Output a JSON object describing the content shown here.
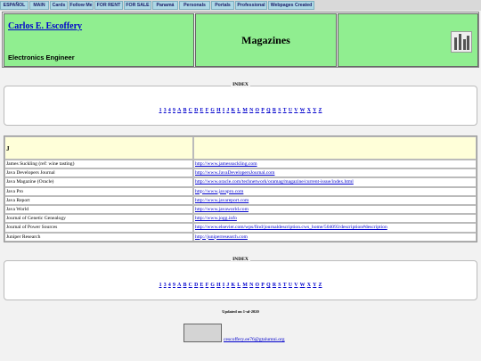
{
  "nav": [
    "ESPAÑOL",
    "MAIN",
    "Cards",
    "Follow Me",
    "FOR RENT",
    "FOR SALE",
    "Panamá",
    "Personals",
    "Portals",
    "Professional",
    "Webpages Created"
  ],
  "header": {
    "name": "Carlos E. Escoffery",
    "subtitle": "Electronics Engineer",
    "title": "Magazines",
    "thumb_icon": "building-photo"
  },
  "index": {
    "label": "INDEX",
    "links": [
      "1",
      "3",
      "4",
      "9",
      "A",
      "B",
      "C",
      "D",
      "E",
      "F",
      "G",
      "H",
      "I",
      "J",
      "K",
      "L",
      "M",
      "N",
      "O",
      "P",
      "Q",
      "R",
      "S",
      "T",
      "U",
      "V",
      "W",
      "X",
      "Y",
      "Z"
    ]
  },
  "section": {
    "letter": "J",
    "rows": [
      {
        "name": "James Suckling (ref: wine tasting)",
        "url": "http://www.jamessuckling.com"
      },
      {
        "name": "Java Developers Journal",
        "url": "http://www.JavaDevelopersJournal.com"
      },
      {
        "name": "Java Magazine (Oracle)",
        "url": "http://www.oracle.com/technetwork/oramag/magazine/current-issue/index.html"
      },
      {
        "name": "Java Pro",
        "url": "http://www.javapro.com"
      },
      {
        "name": "Java Report",
        "url": "http://www.javareport.com"
      },
      {
        "name": "Java World",
        "url": "http://www.javaworld.com"
      },
      {
        "name": "Journal of Genetic Genealogy",
        "url": "http://www.jogg.info"
      },
      {
        "name": "Journal of Power Sources",
        "url": "http://www.elsevier.com/wps/find/journaldescription.cws_home/504093/description#description"
      },
      {
        "name": "Juniper Research",
        "url": "http://juniperresearch.com"
      }
    ]
  },
  "footer": {
    "updated": "Updated on 1-ul-2020",
    "email": "cescoffery.ee76@gtalumni.org"
  }
}
